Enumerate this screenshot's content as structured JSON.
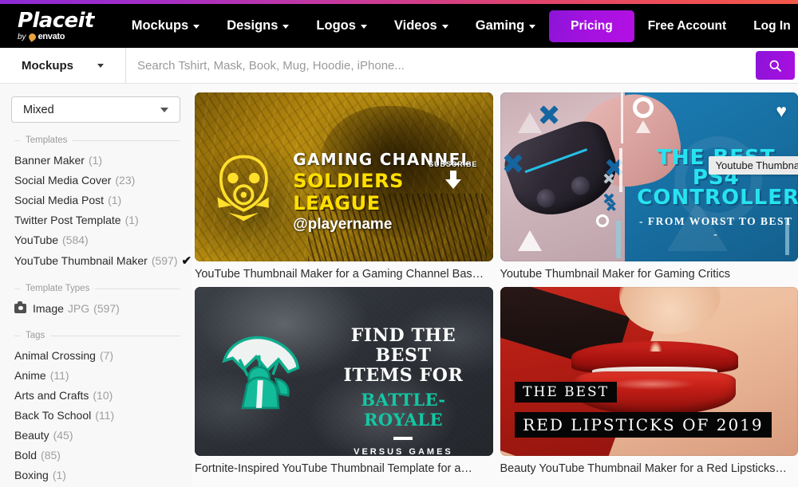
{
  "brand": {
    "logo_main": "Place",
    "logo_main_it": "it",
    "logo_by": "by",
    "logo_envato": "envato",
    "accent_purple": "#a612e0",
    "gradient_start": "#8b2bd4",
    "gradient_end": "#f25a4a"
  },
  "nav": {
    "items": [
      {
        "label": "Mockups",
        "has_caret": true
      },
      {
        "label": "Designs",
        "has_caret": true
      },
      {
        "label": "Logos",
        "has_caret": true
      },
      {
        "label": "Videos",
        "has_caret": true
      },
      {
        "label": "Gaming",
        "has_caret": true
      }
    ],
    "pricing": "Pricing",
    "free_account": "Free Account",
    "log_in": "Log In"
  },
  "search": {
    "category": "Mockups",
    "placeholder": "Search Tshirt, Mask, Book, Mug, Hoodie, iPhone...",
    "value": "",
    "button_icon": "search-icon"
  },
  "sidebar": {
    "sort_value": "Mixed",
    "groups": [
      {
        "title": "Templates",
        "items": [
          {
            "label": "Banner Maker",
            "count": "(1)",
            "selected": false
          },
          {
            "label": "Social Media Cover",
            "count": "(23)",
            "selected": false
          },
          {
            "label": "Social Media Post",
            "count": "(1)",
            "selected": false
          },
          {
            "label": "Twitter Post Template",
            "count": "(1)",
            "selected": false
          },
          {
            "label": "YouTube",
            "count": "(584)",
            "selected": false
          },
          {
            "label": "YouTube Thumbnail Maker",
            "count": "(597)",
            "selected": true
          }
        ]
      },
      {
        "title": "Template Types",
        "items": [
          {
            "label": "Image",
            "sub": "JPG",
            "count": "(597)",
            "icon": "camera-icon",
            "selected": false
          }
        ]
      },
      {
        "title": "Tags",
        "items": [
          {
            "label": "Animal Crossing",
            "count": "(7)",
            "selected": false
          },
          {
            "label": "Anime",
            "count": "(11)",
            "selected": false
          },
          {
            "label": "Arts and Crafts",
            "count": "(10)",
            "selected": false
          },
          {
            "label": "Back To School",
            "count": "(11)",
            "selected": false
          },
          {
            "label": "Beauty",
            "count": "(45)",
            "selected": false
          },
          {
            "label": "Bold",
            "count": "(85)",
            "selected": false
          },
          {
            "label": "Boxing",
            "count": "(1)",
            "selected": false
          }
        ]
      }
    ],
    "check_glyph": "✔"
  },
  "tooltip": {
    "text": "Youtube Thumbnai"
  },
  "results": {
    "cards": [
      {
        "title": "YouTube Thumbnail Maker for a Gaming Channel Bas…",
        "favorited": false,
        "art": {
          "line1": "GAMING CHANNEL",
          "line2": "SOLDIERS LEAGUE",
          "line3": "@playername",
          "subscribe": "SUBSCRIBE"
        }
      },
      {
        "title": "Youtube Thumbnail Maker for Gaming Critics",
        "favorited": true,
        "favorite_icon": "heart-icon",
        "art": {
          "line1": "THE BEST PS4",
          "line2": "CONTROLLERS",
          "line3": "- FROM WORST TO BEST -"
        }
      },
      {
        "title": "Fortnite-Inspired YouTube Thumbnail Template for a…",
        "favorited": false,
        "art": {
          "line1": "FIND THE BEST",
          "line2": "ITEMS FOR",
          "line3": "BATTLE-ROYALE",
          "line4": "VERSUS GAMES"
        }
      },
      {
        "title": "Beauty YouTube Thumbnail Maker for a Red Lipsticks…",
        "favorited": false,
        "art": {
          "line1": "THE BEST",
          "line2": "RED LIPSTICKS OF 2019"
        }
      }
    ]
  }
}
